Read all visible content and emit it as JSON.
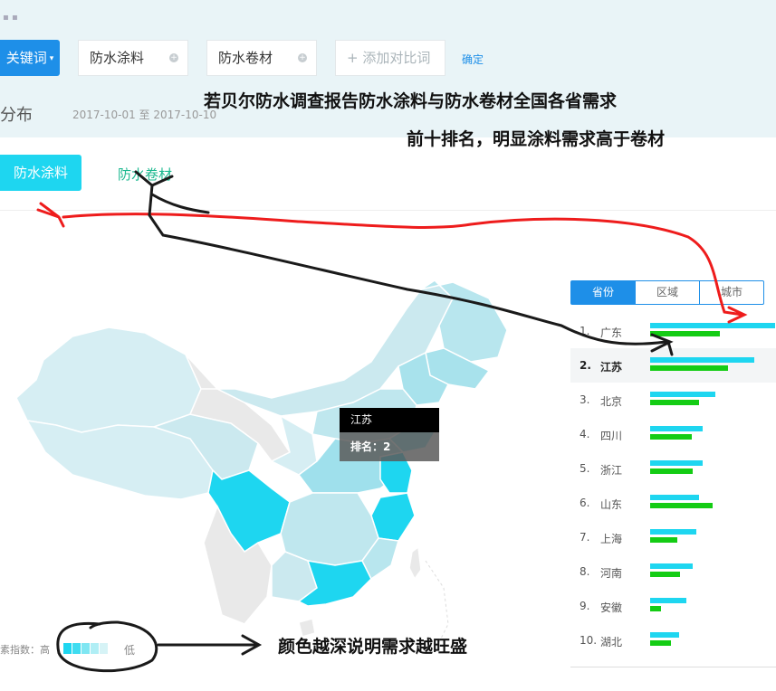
{
  "header": {
    "logo_text": "▪ ▪",
    "keyword_button": "关键词",
    "caret": "▾",
    "chips": [
      {
        "label": "防水涂料",
        "remove": "+"
      },
      {
        "label": "防水卷材",
        "remove": "+"
      }
    ],
    "add_compare": "+ 添加对比词",
    "confirm": "确定"
  },
  "section": {
    "title": "分布",
    "date_range": "2017-10-01 至 2017-10-10"
  },
  "annotations": {
    "line1": "若贝尔防水调查报告防水涂料与防水卷材全国各省需求",
    "line2": "前十排名，明显涂料需求高于卷材",
    "legend_note": "颜色越深说明需求越旺盛"
  },
  "tabs": [
    {
      "label": "防水涂料",
      "active": true
    },
    {
      "label": "防水卷材",
      "active": false
    }
  ],
  "tooltip": {
    "province": "江苏",
    "rank_text": "排名：2"
  },
  "legend": {
    "label": "素指数：高",
    "low": "低",
    "swatches": [
      "#1ed6f0",
      "#3fdcf0",
      "#7fe6f2",
      "#b0eef5",
      "#d6f3f6"
    ]
  },
  "segment": [
    {
      "label": "省份",
      "active": true
    },
    {
      "label": "区域",
      "active": false
    },
    {
      "label": "城市",
      "active": false
    }
  ],
  "colors": {
    "primary": "#1e8fe8",
    "cyan": "#1ed6f0",
    "green": "#14cc14",
    "tab_green": "#1bb88f"
  },
  "ranking": [
    {
      "rank": "1.",
      "name": "广东",
      "coating": 1.0,
      "roll": 0.56
    },
    {
      "rank": "2.",
      "name": "江苏",
      "coating": 0.83,
      "roll": 0.62,
      "highlight": true
    },
    {
      "rank": "3.",
      "name": "北京",
      "coating": 0.52,
      "roll": 0.39
    },
    {
      "rank": "4.",
      "name": "四川",
      "coating": 0.42,
      "roll": 0.33
    },
    {
      "rank": "5.",
      "name": "浙江",
      "coating": 0.42,
      "roll": 0.34
    },
    {
      "rank": "6.",
      "name": "山东",
      "coating": 0.39,
      "roll": 0.5
    },
    {
      "rank": "7.",
      "name": "上海",
      "coating": 0.37,
      "roll": 0.22
    },
    {
      "rank": "8.",
      "name": "河南",
      "coating": 0.34,
      "roll": 0.24
    },
    {
      "rank": "9.",
      "name": "安徽",
      "coating": 0.29,
      "roll": 0.09
    },
    {
      "rank": "10.",
      "name": "湖北",
      "coating": 0.23,
      "roll": 0.17
    }
  ]
}
